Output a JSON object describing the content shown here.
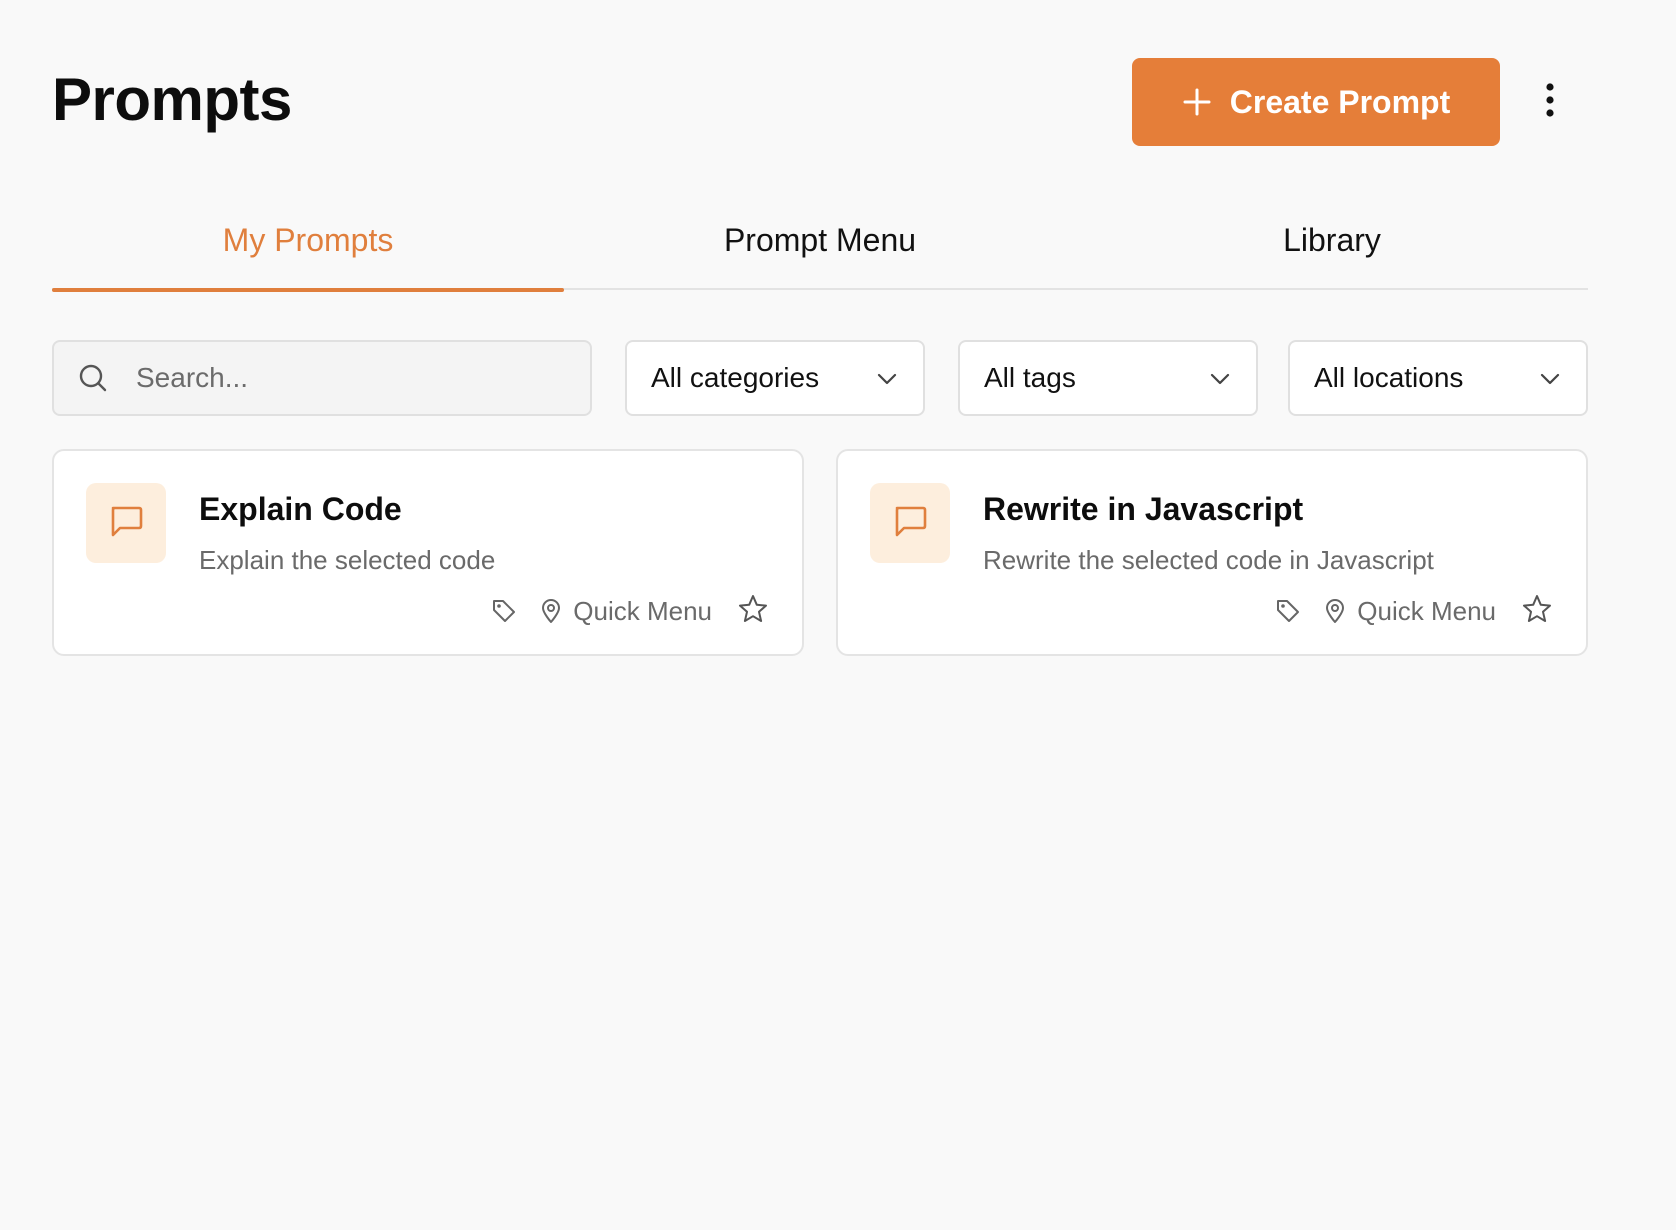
{
  "header": {
    "title": "Prompts",
    "create_button_label": "Create Prompt",
    "more_menu_icon": "vertical-ellipsis-icon"
  },
  "tabs": [
    {
      "label": "My Prompts",
      "active": true
    },
    {
      "label": "Prompt Menu",
      "active": false
    },
    {
      "label": "Library",
      "active": false
    }
  ],
  "filters": {
    "search": {
      "placeholder": "Search...",
      "value": ""
    },
    "category": {
      "selected": "All categories"
    },
    "tags": {
      "selected": "All tags"
    },
    "locations": {
      "selected": "All locations"
    }
  },
  "prompts": [
    {
      "title": "Explain Code",
      "description": "Explain the selected code",
      "location": "Quick Menu",
      "icon": "chat-bubble-icon",
      "favorited": false
    },
    {
      "title": "Rewrite in Javascript",
      "description": "Rewrite the selected code in Javascript",
      "location": "Quick Menu",
      "icon": "chat-bubble-icon",
      "favorited": false
    }
  ],
  "colors": {
    "accent": "#e57e39",
    "accent_text": "#e07f3d",
    "icon_tile_bg": "#fdeedd",
    "page_bg": "#f9f9f9"
  }
}
